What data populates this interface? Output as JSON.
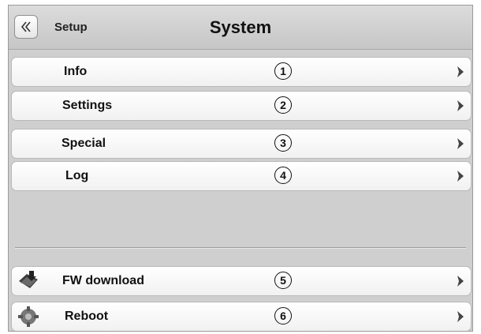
{
  "header": {
    "back_icon": "double-chevron-left-icon",
    "breadcrumb": "Setup",
    "title": "System"
  },
  "menu": {
    "items": [
      {
        "label": "Info",
        "number": "1"
      },
      {
        "label": "Settings",
        "number": "2"
      },
      {
        "label": "Special",
        "number": "3"
      },
      {
        "label": "Log",
        "number": "4"
      }
    ]
  },
  "actions": {
    "items": [
      {
        "label": "FW download",
        "number": "5",
        "icon": "firmware-download-icon"
      },
      {
        "label": "Reboot",
        "number": "6",
        "icon": "reboot-gear-icon"
      }
    ]
  },
  "colors": {
    "background": "#cfcfcf",
    "row": "#ffffff",
    "text": "#111111"
  }
}
